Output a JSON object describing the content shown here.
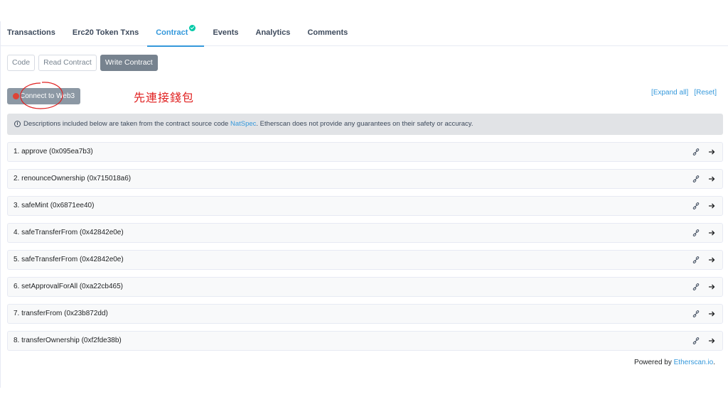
{
  "tabs": [
    {
      "label": "Transactions"
    },
    {
      "label": "Erc20 Token Txns"
    },
    {
      "label": "Contract",
      "active": true
    },
    {
      "label": "Events"
    },
    {
      "label": "Analytics"
    },
    {
      "label": "Comments"
    }
  ],
  "subtabs": [
    {
      "label": "Code"
    },
    {
      "label": "Read Contract"
    },
    {
      "label": "Write Contract",
      "active": true
    }
  ],
  "connect": {
    "label": "Connect to Web3",
    "status_color": "#de4437"
  },
  "annotation": {
    "text": "先連接錢包",
    "color": "#e02020"
  },
  "controls": {
    "expand_all": "[Expand all]",
    "reset": "[Reset]"
  },
  "banner": {
    "icon": "info-icon",
    "prefix": "Descriptions included below are taken from the contract source code ",
    "link": "NatSpec",
    "suffix": ". Etherscan does not provide any guarantees on their safety or accuracy."
  },
  "functions": [
    {
      "label": "1. approve (0x095ea7b3)"
    },
    {
      "label": "2. renounceOwnership (0x715018a6)"
    },
    {
      "label": "3. safeMint (0x6871ee40)"
    },
    {
      "label": "4. safeTransferFrom (0x42842e0e)"
    },
    {
      "label": "5. safeTransferFrom (0x42842e0e)"
    },
    {
      "label": "6. setApprovalForAll (0xa22cb465)"
    },
    {
      "label": "7. transferFrom (0x23b872dd)"
    },
    {
      "label": "8. transferOwnership (0xf2fde38b)"
    }
  ],
  "row_icons": [
    "link-icon",
    "arrow-right-icon"
  ],
  "footer": {
    "prefix": "Powered by ",
    "link": "Etherscan.io",
    "suffix": "."
  },
  "colors": {
    "accent": "#3498db",
    "verified": "#00c9a7",
    "button_gray": "#8c98a4"
  }
}
